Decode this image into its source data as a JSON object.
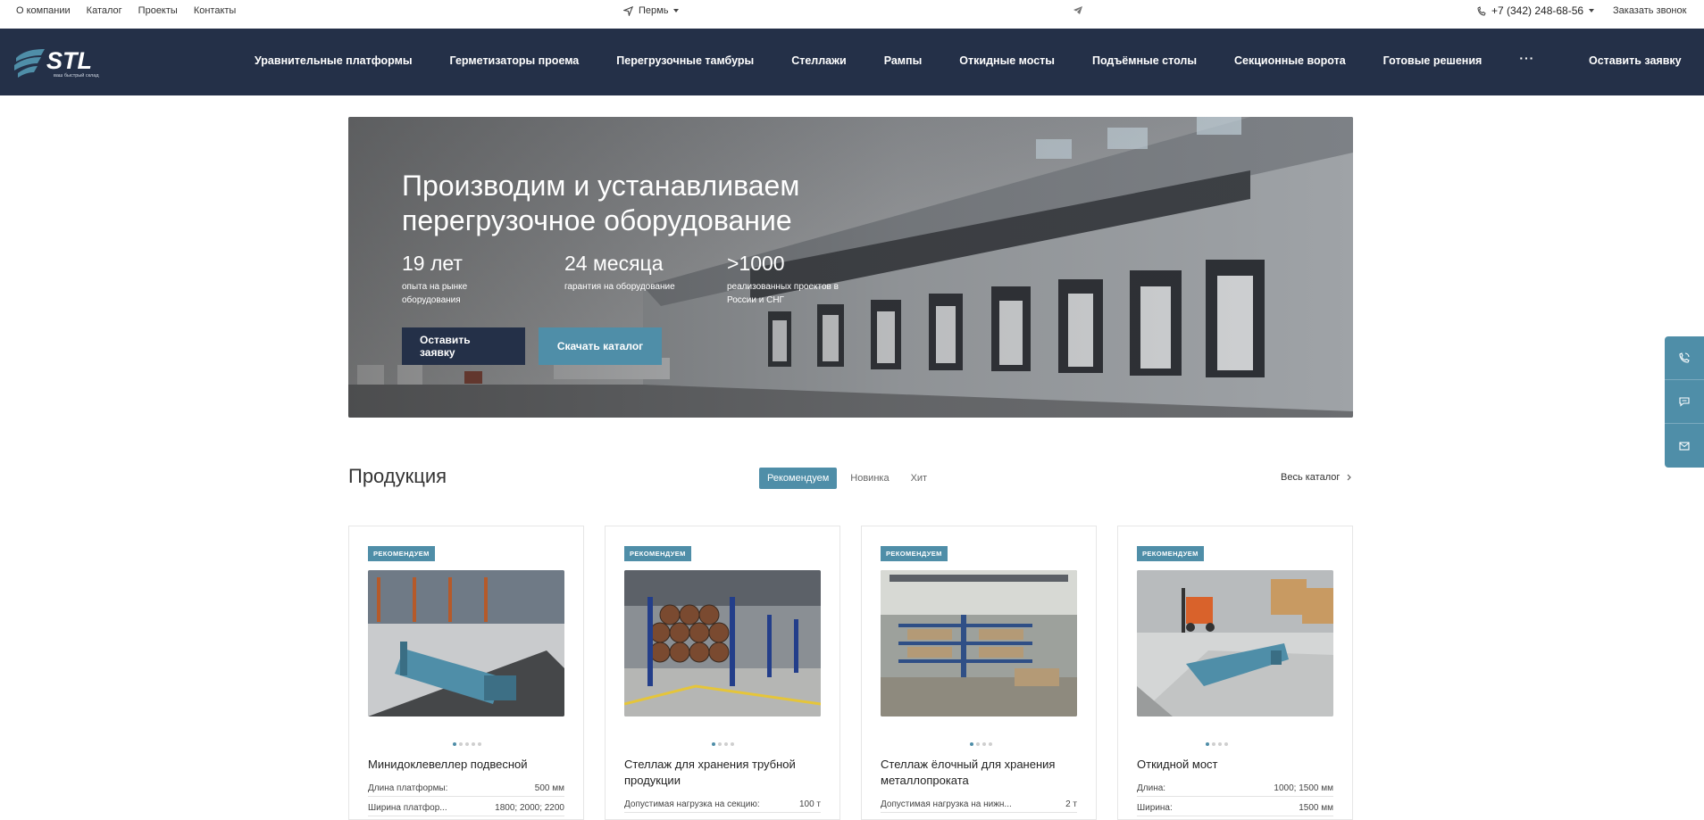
{
  "topbar": {
    "links": [
      "О компании",
      "Каталог",
      "Проекты",
      "Контакты"
    ],
    "city": "Пермь",
    "phone": "+7 (342) 248-68-56",
    "callback": "Заказать звонок"
  },
  "nav": {
    "logo_text": "STL",
    "logo_tagline": "ваш быстрый склад",
    "items": [
      "Уравнительные платформы",
      "Герметизаторы проема",
      "Перегрузочные тамбуры",
      "Стеллажи",
      "Рампы",
      "Откидные мосты",
      "Подъёмные столы",
      "Секционные ворота",
      "Готовые решения"
    ],
    "more": "···",
    "cta": "Оставить заявку"
  },
  "hero": {
    "title": "Производим и устанавливаем перегрузочное оборудование",
    "stats": [
      {
        "value": "19 лет",
        "desc": "опыта на рынке оборудования"
      },
      {
        "value": "24 месяца",
        "desc": "гарантия на оборудование"
      },
      {
        "value": ">1000",
        "desc": "реализованных проектов в России и СНГ"
      }
    ],
    "btn_primary": "Оставить заявку",
    "btn_secondary": "Скачать каталог"
  },
  "products": {
    "title": "Продукция",
    "tabs": [
      "Рекомендуем",
      "Новинка",
      "Хит"
    ],
    "active_tab": "Рекомендуем",
    "all_link": "Весь каталог",
    "cards": [
      {
        "badge": "РЕКОМЕНДУЕМ",
        "name": "Минидоклевеллер подвесной",
        "specs": [
          {
            "label": "Длина платформы:",
            "value": "500 мм"
          },
          {
            "label": "Ширина платфор...",
            "value": "1800; 2000; 2200"
          }
        ]
      },
      {
        "badge": "РЕКОМЕНДУЕМ",
        "name": "Стеллаж для хранения трубной продукции",
        "specs": [
          {
            "label": "Допустимая нагрузка на секцию:",
            "value": "100 т"
          }
        ]
      },
      {
        "badge": "РЕКОМЕНДУЕМ",
        "name": "Стеллаж ёлочный для хранения металлопроката",
        "specs": [
          {
            "label": "Допустимая нагрузка на нижн...",
            "value": "2 т"
          }
        ]
      },
      {
        "badge": "РЕКОМЕНДУЕМ",
        "name": "Откидной мост",
        "specs": [
          {
            "label": "Длина:",
            "value": "1000; 1500 мм"
          },
          {
            "label": "Ширина:",
            "value": "1500 мм"
          }
        ]
      }
    ]
  },
  "colors": {
    "navy": "#243048",
    "teal": "#4f8ea8"
  }
}
